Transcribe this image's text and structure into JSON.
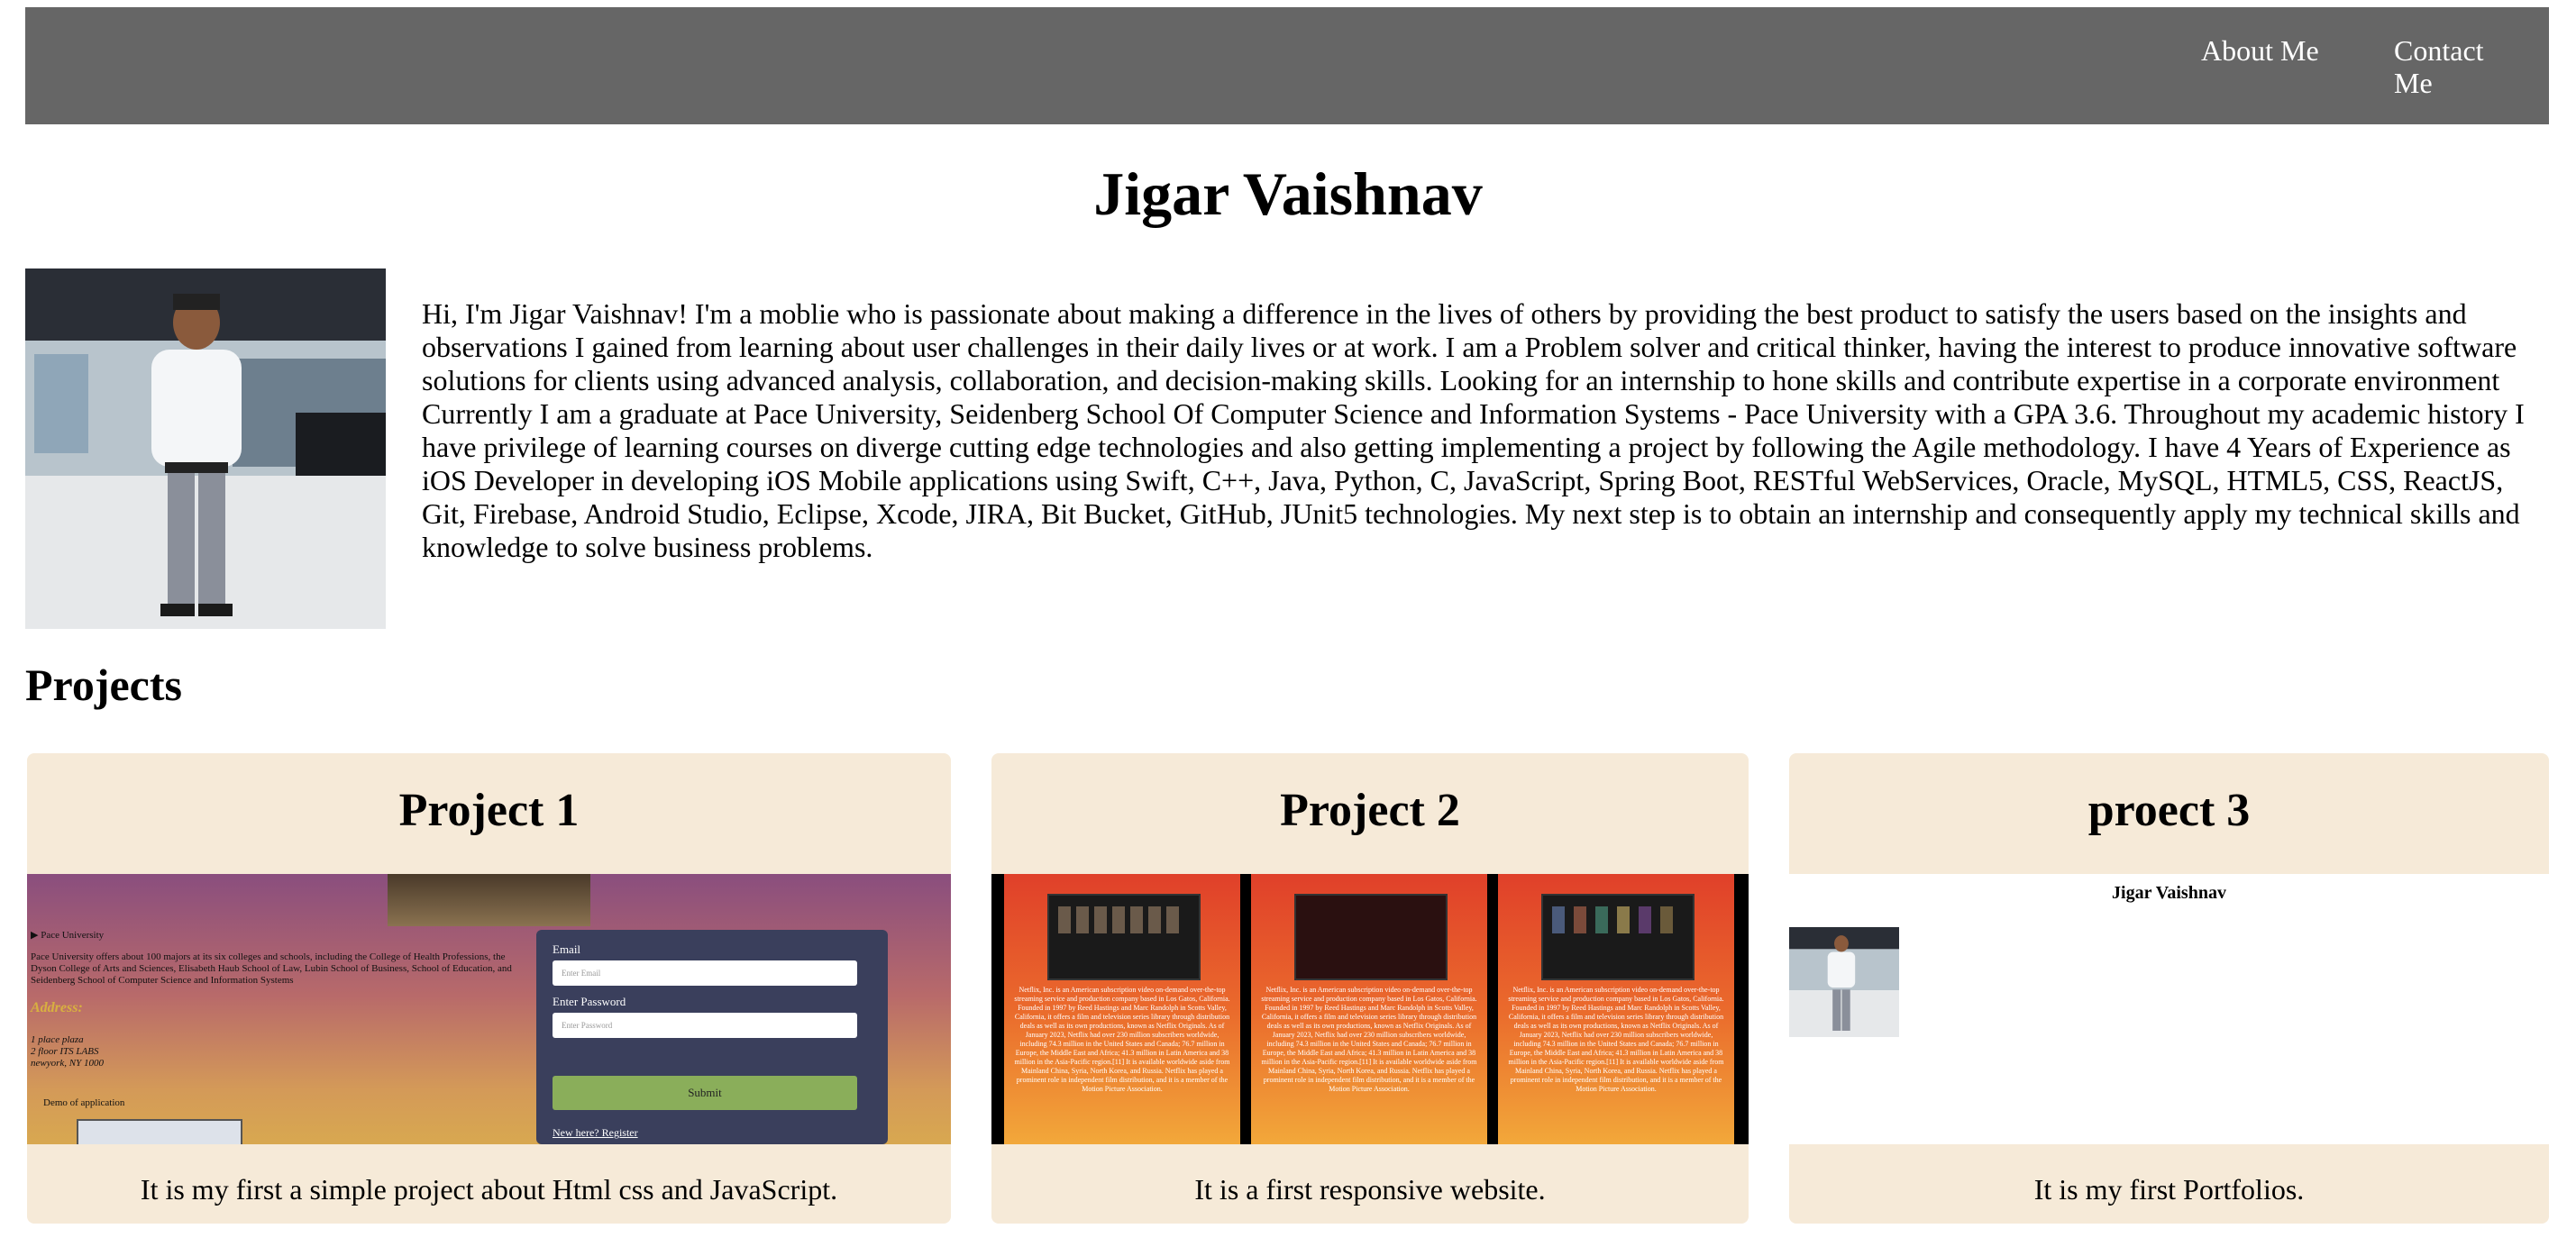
{
  "nav": {
    "about": "About Me",
    "contact": "Contact Me"
  },
  "title": "Jigar Vaishnav",
  "bio": "Hi, I'm Jigar Vaishnav! I'm a moblie who is passionate about making a difference in the lives of others by providing the best product to satisfy the users based on the insights and observations I gained from learning about user challenges in their daily lives or at work. I am a Problem solver and critical thinker, having the interest to produce innovative software solutions for clients using advanced analysis, collaboration, and decision-making skills. Looking for an internship to hone skills and contribute expertise in a corporate environment Currently I am a graduate at Pace University, Seidenberg School Of Computer Science and Information Systems - Pace University with a GPA 3.6. Throughout my academic history I have privilege of learning courses on diverge cutting edge technologies and also getting implementing a project by following the Agile methodology. I have 4 Years of Experience as iOS Developer in developing iOS Mobile applications using Swift, C++, Java, Python, C, JavaScript, Spring Boot, RESTful WebServices, Oracle, MySQL, HTML5, CSS, ReactJS, Git, Firebase, Android Studio, Eclipse, Xcode, JIRA, Bit Bucket, GitHub, JUnit5 technologies. My next step is to obtain an internship and consequently apply my technical skills and knowledge to solve business problems.",
  "projects_heading": "Projects",
  "projects": [
    {
      "title": "Project 1",
      "description": "It is my first a simple project about Html css and JavaScript.",
      "preview": {
        "list_item": "▶ Pace University",
        "paragraph": "Pace University offers about 100 majors at its six colleges and schools, including the College of Health Professions, the Dyson College of Arts and Sciences, Elisabeth Haub School of Law, Lubin School of Business, School of Education, and Seidenberg School of Computer Science and Information Systems",
        "address_label": "Address:",
        "address_lines": [
          "1 place plaza",
          "2 floor ITS LABS",
          "newyork, NY 1000"
        ],
        "demo_label": "Demo of application",
        "email_label": "Email",
        "email_placeholder": "Enter Email",
        "password_label": "Enter Password",
        "password_placeholder": "Enter Password",
        "submit": "Submit",
        "register": "New here? Register"
      }
    },
    {
      "title": "Project 2",
      "description": "It is a first responsive website.",
      "preview": {
        "panel_text": "Netflix, Inc. is an American subscription video on-demand over-the-top streaming service and production company based in Los Gatos, California. Founded in 1997 by Reed Hastings and Marc Randolph in Scotts Valley, California, it offers a film and television series library through distribution deals as well as its own productions, known as Netflix Originals. As of January 2023, Netflix had over 230 million subscribers worldwide, including 74.3 million in the United States and Canada; 76.7 million in Europe, the Middle East and Africa; 41.3 million in Latin America and 38 million in the Asia-Pacific region.[11] It is available worldwide aside from Mainland China, Syria, North Korea, and Russia. Netflix has played a prominent role in independent film distribution, and it is a member of the Motion Picture Association."
      }
    },
    {
      "title": "proect 3",
      "description": "It is my first Portfolios.",
      "preview": {
        "name": "Jigar Vaishnav"
      }
    }
  ]
}
